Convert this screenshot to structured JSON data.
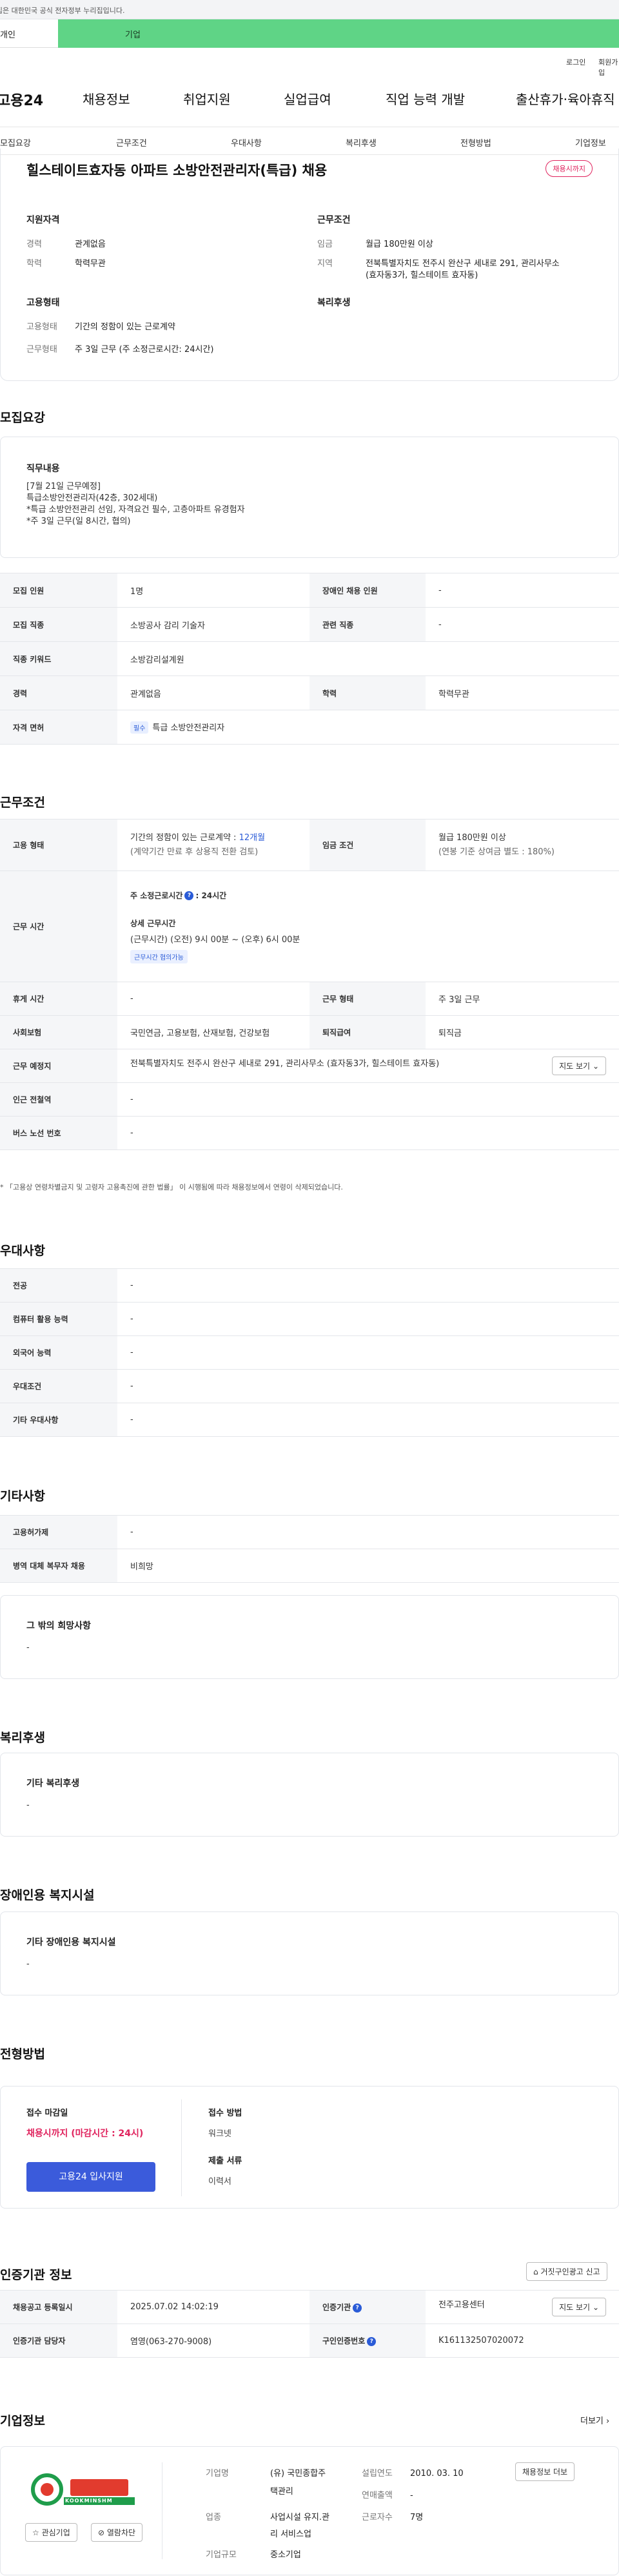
{
  "gov_notice": "이 누리집은 대한민국 공식 전자정부 누리집입니다.",
  "tabs": {
    "personal": "개인",
    "company": "기업"
  },
  "util": {
    "login": "로그인",
    "join": "회원가입"
  },
  "gnb": {
    "logo": "고용24",
    "items": [
      "채용정보",
      "취업지원",
      "실업급여",
      "직업 능력 개발",
      "출산휴가·육아휴직"
    ]
  },
  "lnb": [
    "모집요강",
    "근무조건",
    "우대사항",
    "복리후생",
    "전형방법",
    "기업정보"
  ],
  "summary": {
    "title": "힐스테이트효자동 아파트 소방안전관리자(특급) 채용",
    "badge": "채용시까지",
    "qual_label": "지원자격",
    "career_k": "경력",
    "career_v": "관계없음",
    "edu_k": "학력",
    "edu_v": "학력무관",
    "cond_label": "근무조건",
    "wage_k": "임금",
    "wage_v": "월급 180만원 이상",
    "region_k": "지역",
    "region_v1": "전북특별자치도 전주시 완산구 세내로 291, 관리사무소",
    "region_v2": "(효자동3가, 힐스테이트 효자동)",
    "emp_label": "고용형태",
    "emptype_k": "고용형태",
    "emptype_v": "기간의 정함이 있는 근로계약",
    "worktype_k": "근무형태",
    "worktype_v": "주 3일 근무 (주 소정근로시간: 24시간)",
    "welfare_label": "복리후생"
  },
  "recruit": {
    "title": "모집요강",
    "duty_label": "직무내용",
    "duty_text": "[7월 21일 근무예정]\n특급소방안전관리자(42층, 302세대)\n*특급 소방안전관리 선임, 자격요건 필수, 고층아파트 유경험자\n*주 3일 근무(일 8시간, 협의)",
    "rows": {
      "count_k": "모집 인원",
      "count_v": "1명",
      "disabled_k": "장애인 채용 인원",
      "disabled_v": "-",
      "job_k": "모집 직종",
      "job_v": "소방공사 감리 기술자",
      "related_k": "관련 직종",
      "related_v": "-",
      "keyword_k": "직종 키워드",
      "keyword_v": "소방감리설계원",
      "career_k": "경력",
      "career_v": "관계없음",
      "edu_k": "학력",
      "edu_v": "학력무관",
      "license_k": "자격 면허",
      "license_tag": "필수",
      "license_v": "특급 소방안전관리자"
    }
  },
  "work": {
    "title": "근무조건",
    "emp_k": "고용 형태",
    "emp_v1a": "기간의 정함이 있는 근로계약 : ",
    "emp_v1b": "12개월",
    "emp_v2": "(계약기간 만료 후 상용직 전환 검토)",
    "wage_k": "임금 조건",
    "wage_v1": "월급 180만원 이상",
    "wage_v2": "(연봉 기준 상여금 별도 : 180%)",
    "hours_k": "근무 시간",
    "hours_total": "주 소정근로시간",
    "hours_total_v": ": 24시간",
    "hours_detail_label": "상세 근무시간",
    "hours_detail": "(근무시간) (오전) 9시 00분 ~ (오후) 6시 00분",
    "hours_pill": "근무시간 협의가능",
    "rest_k": "휴게 시간",
    "rest_v": "-",
    "form_k": "근무 형태",
    "form_v": "주 3일 근무",
    "ins_k": "사회보험",
    "ins_v": "국민연금, 고용보험, 산재보험, 건강보험",
    "ret_k": "퇴직급여",
    "ret_v": "퇴직금",
    "place_k": "근무 예정지",
    "place_v": "전북특별자치도 전주시 완산구 세내로 291, 관리사무소 (효자동3가, 힐스테이트 효자동)",
    "map_btn": "지도 보기",
    "subway_k": "인근 전철역",
    "subway_v": "-",
    "bus_k": "버스 노선 번호",
    "bus_v": "-",
    "note": "* 「고용상 연령차별금지 및 고령자 고용촉진에 관한 법률」 이 시행됨에 따라 채용정보에서 연령이 삭제되었습니다."
  },
  "pref": {
    "title": "우대사항",
    "rows": [
      {
        "k": "전공",
        "v": "-"
      },
      {
        "k": "컴퓨터 활용 능력",
        "v": "-"
      },
      {
        "k": "외국어 능력",
        "v": "-"
      },
      {
        "k": "우대조건",
        "v": "-"
      },
      {
        "k": "기타 우대사항",
        "v": "-"
      }
    ]
  },
  "etc": {
    "title": "기타사항",
    "rows": [
      {
        "k": "고용허가제",
        "v": "-"
      },
      {
        "k": "병역 대체 복무자 채용",
        "v": "비희망"
      }
    ],
    "box_label": "그 밖의 희망사항",
    "box_text": "-"
  },
  "welfare": {
    "title": "복리후생",
    "box_label": "기타 복리후생",
    "box_text": "-"
  },
  "disability": {
    "title": "장애인용 복지시설",
    "box_label": "기타 장애인용 복지시설",
    "box_text": "-"
  },
  "selection": {
    "title": "전형방법",
    "deadline_label": "접수 마감일",
    "deadline_v": "채용시까지 (마감시간 : 24시)",
    "apply_btn": "고용24 입사지원",
    "method_label": "접수 방법",
    "method_v": "워크넷",
    "docs_label": "제출 서류",
    "docs_v": "이력서"
  },
  "agency": {
    "title": "인증기관 정보",
    "report_btn": "거짓구인광고 신고",
    "reg_k": "채용공고 등록일시",
    "reg_v": "2025.07.02 14:02:19",
    "org_k": "인증기관",
    "org_v": "전주고용센터",
    "map_btn": "지도 보기",
    "manager_k": "인증기관 담당자",
    "manager_v": "염영(063-270-9008)",
    "no_k": "구인인증번호",
    "no_v": "K161132507020072"
  },
  "company": {
    "title": "기업정보",
    "more": "더보기",
    "logo_text": "KOOKMINSHM",
    "fav_btn": "관심기업",
    "block_btn": "열람차단",
    "name_k": "기업명",
    "name_v1": "(유) 국민종합주",
    "name_v2": "택관리",
    "founded_k": "설립연도",
    "founded_v": "2010. 03. 10",
    "job_btn": "채용정보 더보",
    "biz_k": "업종",
    "biz_v1": "사업시설 유지.관",
    "biz_v2": "리 서비스업",
    "sales_k": "연매출액",
    "sales_v": "-",
    "staff_k": "근로자수",
    "staff_v": "7명",
    "size_k": "기업규모",
    "size_v": "중소기업"
  },
  "colors": {
    "accent": "#3b5bdb",
    "green_tab": "#5fd486",
    "deadline": "#e0245e"
  }
}
